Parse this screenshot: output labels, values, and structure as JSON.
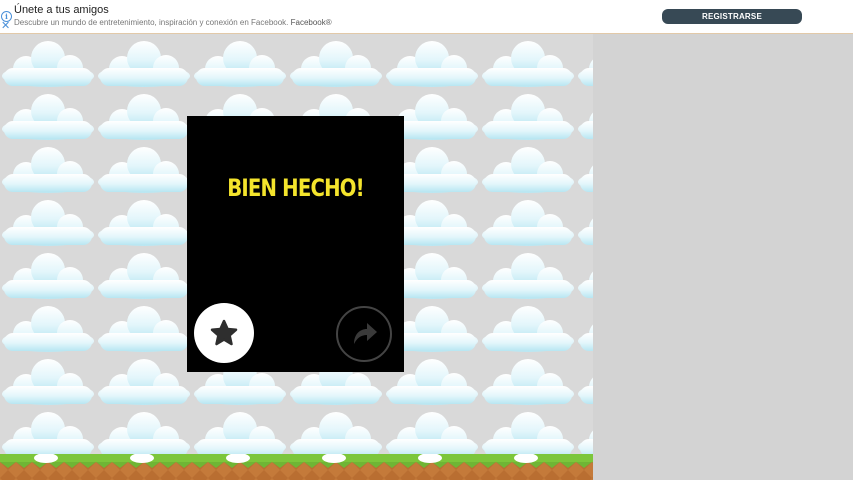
{
  "ad": {
    "title": "Únete a tus amigos",
    "description": "Descubre un mundo de entretenimiento, inspiración y conexión en Facebook.",
    "brand": "Facebook®",
    "cta_label": "REGISTRARSE",
    "info_icon": "info-icon",
    "close_icon": "close-icon"
  },
  "dialog": {
    "title": "BIEN HECHO!",
    "star_icon": "star-icon",
    "next_icon": "share-arrow-icon"
  },
  "colors": {
    "title_yellow": "#f4e42c",
    "ad_button": "#374955",
    "grass": "#7cc63b",
    "dirt": "#c47a3a"
  }
}
